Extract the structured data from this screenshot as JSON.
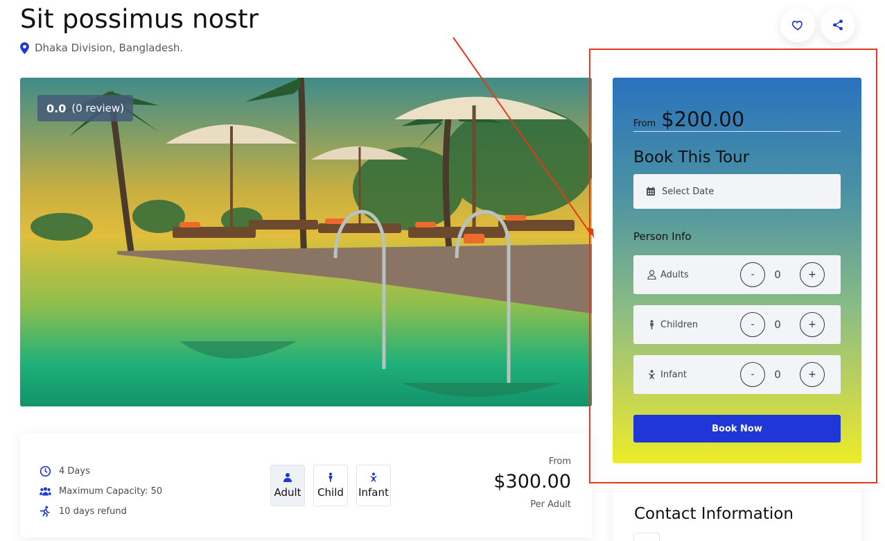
{
  "tour": {
    "title": "Sit possimus nostr",
    "location": "Dhaka Division, Bangladesh."
  },
  "actions": {
    "favorite_icon": "heart-icon",
    "share_icon": "share-icon"
  },
  "hero": {
    "rating_score": "0.0",
    "rating_count": "(0 review)"
  },
  "info": {
    "facts": [
      {
        "icon": "clock-icon",
        "text": "4 Days"
      },
      {
        "icon": "group-icon",
        "text": "Maximum Capacity: 50"
      },
      {
        "icon": "refund-icon",
        "text": "10 days refund"
      }
    ],
    "person_types": [
      {
        "icon": "adult-icon",
        "label": "Adult"
      },
      {
        "icon": "child-icon",
        "label": "Child"
      },
      {
        "icon": "infant-icon",
        "label": "Infant"
      }
    ],
    "price_from_label": "From",
    "price": "$300.00",
    "price_unit": "Per Adult"
  },
  "booking": {
    "from_label": "From",
    "price": "$200.00",
    "heading": "Book This Tour",
    "date_placeholder": "Select Date",
    "person_heading": "Person Info",
    "counters": [
      {
        "icon": "user-icon",
        "label": "Adults",
        "value": "0",
        "minus": "-",
        "plus": "+"
      },
      {
        "icon": "child-icon",
        "label": "Children",
        "value": "0",
        "minus": "-",
        "plus": "+"
      },
      {
        "icon": "infant-icon",
        "label": "Infant",
        "value": "0",
        "minus": "-",
        "plus": "+"
      }
    ],
    "button": "Book Now"
  },
  "contact": {
    "heading": "Contact Information"
  },
  "colors": {
    "accent": "#1e37d6",
    "annotation": "#e3391b"
  }
}
